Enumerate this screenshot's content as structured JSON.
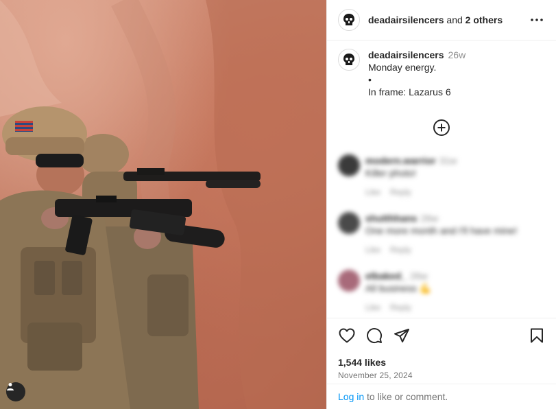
{
  "header": {
    "username": "deadairsilencers",
    "and_text": "and",
    "others": "2 others",
    "more_icon": "more-horizontal-icon"
  },
  "caption": {
    "username": "deadairsilencers",
    "time": "26w",
    "line1": "Monday energy.",
    "line2": "•",
    "line3": "In frame: Lazarus 6"
  },
  "add_icon": "add-circle-icon",
  "comments": [
    {
      "username": "modern.warrior",
      "time": "31w",
      "text": "Killer photo!",
      "like": "Like",
      "reply": "Reply",
      "avatar_color": "#3a3a3a"
    },
    {
      "username": "shutthhans",
      "time": "26w",
      "text": "One more month and I'll have mine!",
      "like": "Like",
      "reply": "Reply",
      "avatar_color": "#4a4a4a"
    },
    {
      "username": "elbaked_",
      "time": "26w",
      "text": "All business 💪",
      "like": "Like",
      "reply": "Reply",
      "avatar_color": "#a86a7a"
    }
  ],
  "actions": {
    "like_icon": "heart-icon",
    "comment_icon": "comment-icon",
    "share_icon": "send-icon",
    "save_icon": "bookmark-icon"
  },
  "likes": "1,544 likes",
  "date": "November 25, 2024",
  "login": {
    "link": "Log in",
    "rest": " to like or comment."
  }
}
